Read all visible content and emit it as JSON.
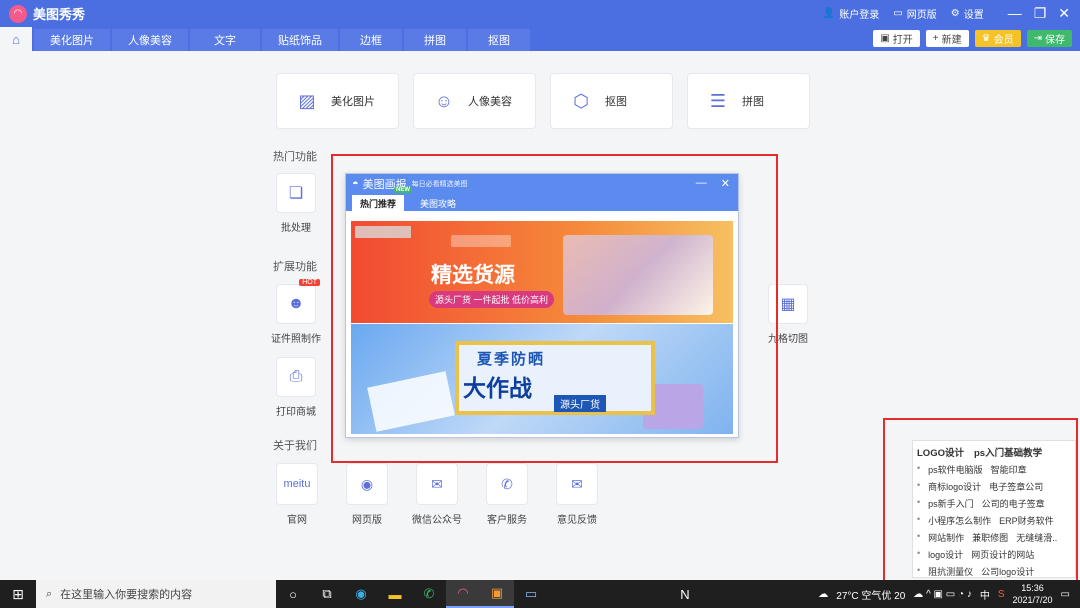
{
  "app": {
    "name": "美图秀秀"
  },
  "titlebar": {
    "account": "账户登录",
    "web": "网页版",
    "settings": "设置"
  },
  "tabs": [
    "美化图片",
    "人像美容",
    "文字",
    "贴纸饰品",
    "边框",
    "拼图",
    "抠图"
  ],
  "toolbar": {
    "open": "打开",
    "new": "新建",
    "vip": "会员",
    "save": "保存"
  },
  "main_tiles": [
    "美化图片",
    "人像美容",
    "抠图",
    "拼图"
  ],
  "sections": {
    "hot": "热门功能",
    "ext": "扩展功能",
    "about": "关于我们"
  },
  "hot_items": [
    "批处理"
  ],
  "ext_items": [
    "证件照制作",
    "九格切图",
    "打印商城"
  ],
  "hot_badge": "HOT",
  "about_items": [
    "官网",
    "网页版",
    "微信公众号",
    "客户服务",
    "意见反馈"
  ],
  "about_logo_text": "meitu",
  "popup": {
    "title": "美图画报",
    "subtitle": "每日必看精选美图",
    "tab_active": "热门推荐",
    "tab_badge": "NEW",
    "tab_other": "美图攻略",
    "banner1_title": "精选货源",
    "banner1_tag": "源头厂货 一件起批 低价高利",
    "banner2_top": "夏季防晒",
    "banner2_main": "大作战",
    "banner2_tag": "源头厂货"
  },
  "ad": {
    "title_a": "LOGO设计",
    "title_b": "ps入门基础教学",
    "rows": [
      [
        "ps软件电脑版",
        "智能印章"
      ],
      [
        "商标logo设计",
        "电子签章公司"
      ],
      [
        "ps新手入门",
        "公司的电子签章"
      ],
      [
        "小程序怎么制作",
        "ERP财务软件"
      ],
      [
        "网站制作",
        "兼职修图",
        "无缝缝滑.."
      ],
      [
        "logo设计",
        "网页设计的网站"
      ],
      [
        "阻抗测量仪",
        "公司logo设计"
      ]
    ]
  },
  "taskbar": {
    "search_placeholder": "在这里输入你要搜索的内容",
    "weather": "27°C 空气优 20",
    "ime": "中",
    "time": "15:36",
    "date": "2021/7/20"
  },
  "colors": {
    "brand": "#4b6fe0",
    "highlight_box": "#e52b2b"
  }
}
